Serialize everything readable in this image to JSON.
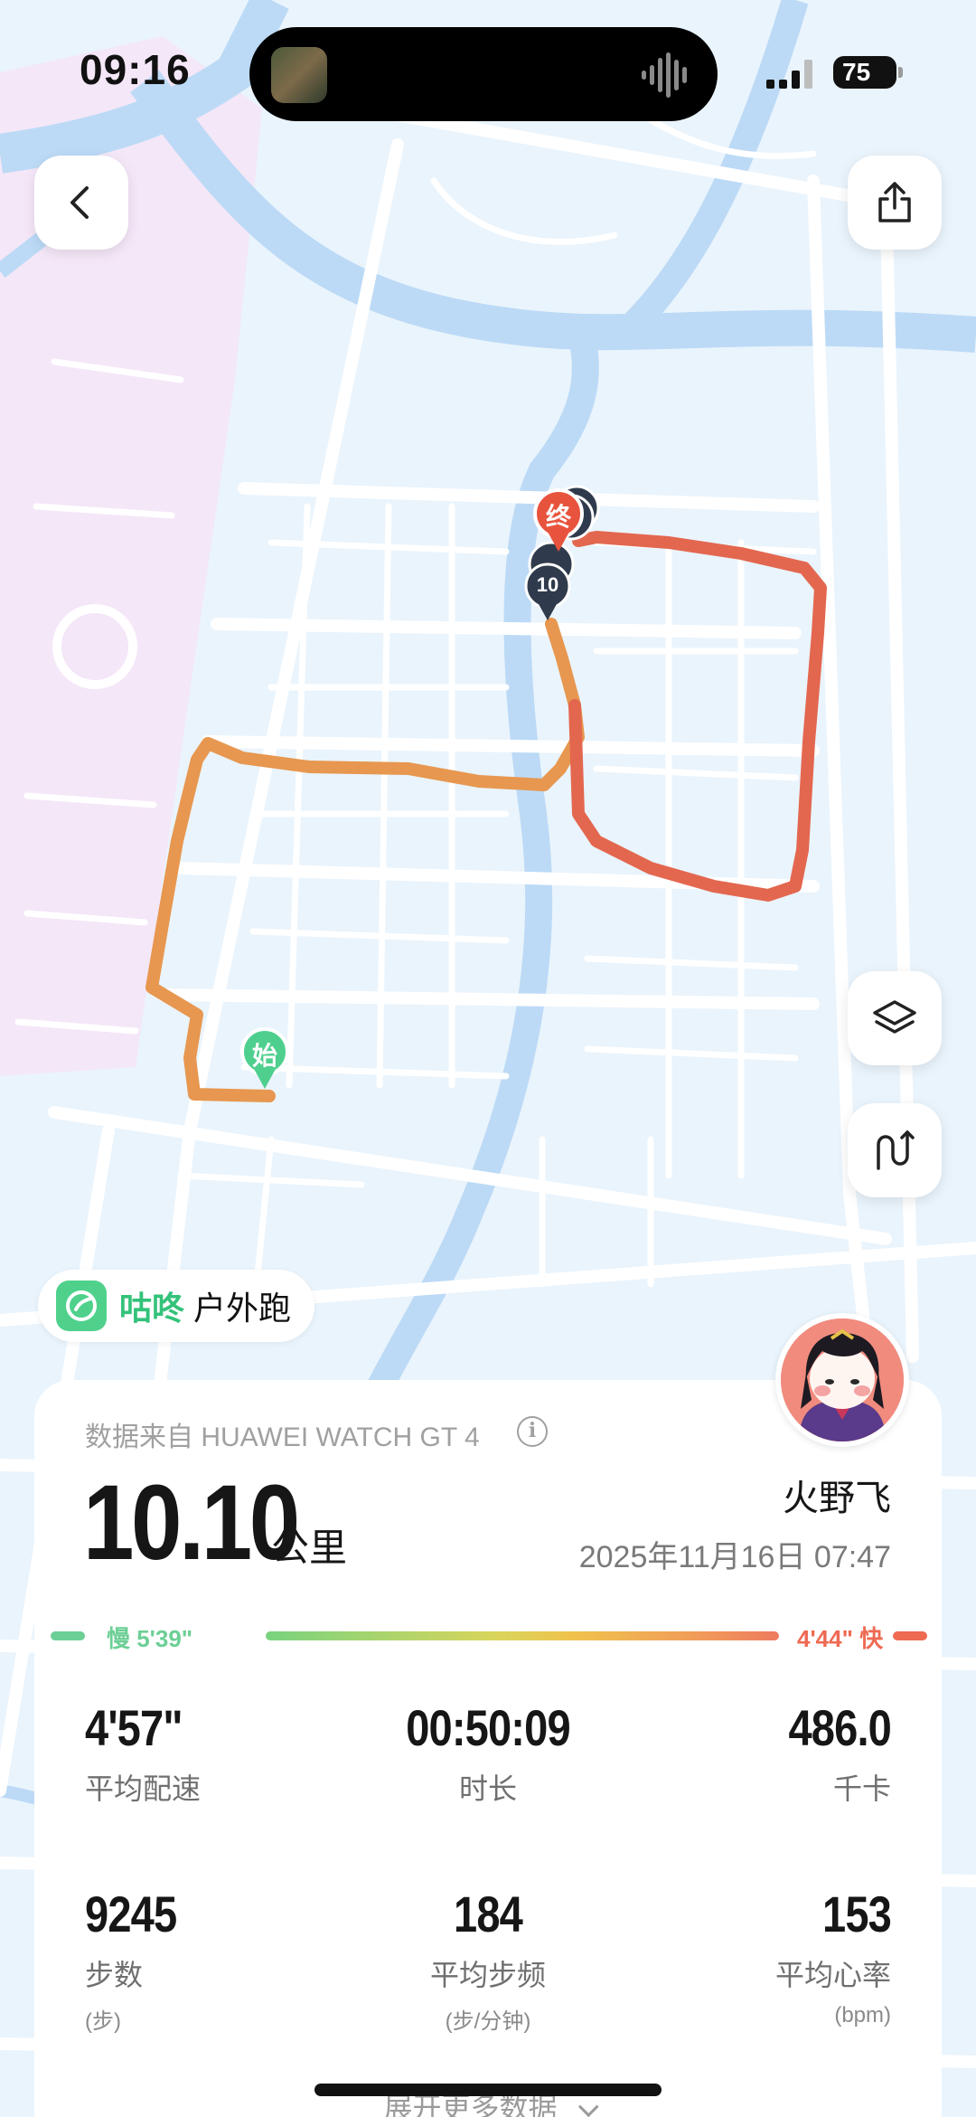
{
  "status_bar": {
    "time": "09:16",
    "battery": "75"
  },
  "map": {
    "start_label": "始",
    "end_label": "终",
    "km_marker": "10"
  },
  "app": {
    "name": "咕咚",
    "activity_type": "户外跑"
  },
  "workout": {
    "source": "数据来自 HUAWEI WATCH GT 4",
    "distance": "10.10",
    "distance_unit": "公里",
    "user_name": "火野飞",
    "datetime": "2025年11月16日 07:47",
    "pace_slow_label": "慢 5'39\"",
    "pace_fast_label": "4'44\" 快",
    "stats": [
      {
        "value": "4'57\"",
        "label": "平均配速",
        "sub": ""
      },
      {
        "value": "00:50:09",
        "label": "时长",
        "sub": ""
      },
      {
        "value": "486.0",
        "label": "千卡",
        "sub": ""
      },
      {
        "value": "9245",
        "label": "步数",
        "sub": "(步)"
      },
      {
        "value": "184",
        "label": "平均步频",
        "sub": "(步/分钟)"
      },
      {
        "value": "153",
        "label": "平均心率",
        "sub": "(bpm)"
      }
    ],
    "expand_label": "展开更多数据"
  },
  "colors": {
    "route_start": "#e9a24f",
    "route_end": "#e3664e",
    "water": "#bcdaf6",
    "pace_slow": "#6ccf95",
    "pace_fast": "#ee6a52",
    "brand_green": "#33c27a"
  },
  "icons": [
    "back-icon",
    "share-icon",
    "layers-icon",
    "route-replay-icon",
    "info-icon",
    "app-logo-icon",
    "signal-icon",
    "battery-icon"
  ]
}
